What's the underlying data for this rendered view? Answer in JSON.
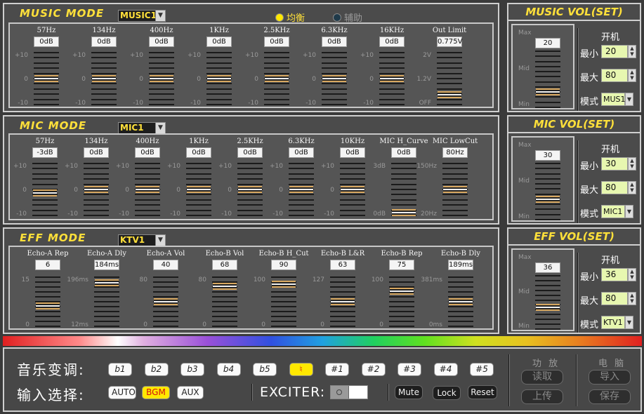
{
  "music": {
    "title": "MUSIC MODE",
    "preset": "MUSIC1",
    "radio_eq": "均衡",
    "radio_aux": "辅助",
    "channels": [
      {
        "label": "57Hz",
        "value": "0dB",
        "level": 0.5
      },
      {
        "label": "134Hz",
        "value": "0dB",
        "level": 0.5
      },
      {
        "label": "400Hz",
        "value": "0dB",
        "level": 0.5
      },
      {
        "label": "1KHz",
        "value": "0dB",
        "level": 0.5
      },
      {
        "label": "2.5KHz",
        "value": "0dB",
        "level": 0.5
      },
      {
        "label": "6.3KHz",
        "value": "0dB",
        "level": 0.5
      },
      {
        "label": "16KHz",
        "value": "0dB",
        "level": 0.5
      },
      {
        "label": "Out Limit",
        "value": "0.775V",
        "level": 0.15
      }
    ],
    "axis_top": "+10",
    "axis_mid": "0",
    "axis_bot": "-10",
    "limit_top": "2V",
    "limit_mid": "1.2V",
    "limit_bot": "OFF"
  },
  "mic": {
    "title": "MIC MODE",
    "preset": "MIC1",
    "channels": [
      {
        "label": "57Hz",
        "value": "-3dB",
        "level": 0.43
      },
      {
        "label": "134Hz",
        "value": "0dB",
        "level": 0.5
      },
      {
        "label": "400Hz",
        "value": "0dB",
        "level": 0.5
      },
      {
        "label": "1KHz",
        "value": "0dB",
        "level": 0.5
      },
      {
        "label": "2.5KHz",
        "value": "0dB",
        "level": 0.5
      },
      {
        "label": "6.3KHz",
        "value": "0dB",
        "level": 0.5
      },
      {
        "label": "10KHz",
        "value": "0dB",
        "level": 0.5
      },
      {
        "label": "MIC H_Curve",
        "value": "0dB",
        "level": 0.0
      },
      {
        "label": "MIC LowCut",
        "value": "80Hz",
        "level": 0.5
      }
    ],
    "hcurve_top": "3dB",
    "hcurve_bot": "0dB",
    "lowcut_top": "150Hz",
    "lowcut_bot": "20Hz"
  },
  "eff": {
    "title": "EFF MODE",
    "preset": "KTV1",
    "channels": [
      {
        "label": "Echo-A Rep",
        "value": "6",
        "level": 0.4,
        "top": "15",
        "bot": "0"
      },
      {
        "label": "Echo-A Dly",
        "value": "184ms",
        "level": 0.94,
        "top": "196ms",
        "bot": "12ms"
      },
      {
        "label": "Echo-A Vol",
        "value": "40",
        "level": 0.5,
        "top": "80",
        "bot": "0"
      },
      {
        "label": "Echo-B Vol",
        "value": "68",
        "level": 0.85,
        "top": "80",
        "bot": "0"
      },
      {
        "label": "Echo-B H_Cut",
        "value": "90",
        "level": 0.9,
        "top": "100",
        "bot": "0"
      },
      {
        "label": "Echo-B L&R",
        "value": "63",
        "level": 0.5,
        "top": "127",
        "bot": "0"
      },
      {
        "label": "Echo-B Rep",
        "value": "75",
        "level": 0.75,
        "top": "100",
        "bot": "0"
      },
      {
        "label": "Echo-B Dly",
        "value": "189ms",
        "level": 0.5,
        "top": "381ms",
        "bot": "0ms"
      }
    ]
  },
  "vol_panels": [
    {
      "title": "MUSIC VOL(SET)",
      "value": "20",
      "level": 0.25,
      "on_label": "开机",
      "min_label": "最小",
      "min": "20",
      "max_label": "最大",
      "max": "80",
      "mode_label": "模式",
      "mode": "MUS1"
    },
    {
      "title": "MIC VOL(SET)",
      "value": "30",
      "level": 0.35,
      "on_label": "开机",
      "min_label": "最小",
      "min": "30",
      "max_label": "最大",
      "max": "80",
      "mode_label": "模式",
      "mode": "MIC1"
    },
    {
      "title": "EFF VOL(SET)",
      "value": "36",
      "level": 0.4,
      "on_label": "开机",
      "min_label": "最小",
      "min": "36",
      "max_label": "最大",
      "max": "80",
      "mode_label": "模式",
      "mode": "KTV1"
    }
  ],
  "vol_axis": {
    "max": "Max",
    "mid": "Mid",
    "min": "Min"
  },
  "bottom": {
    "key_label": "音乐变调:",
    "keys": [
      "b1",
      "b2",
      "b3",
      "b4",
      "b5",
      "♮",
      "#1",
      "#2",
      "#3",
      "#4",
      "#5"
    ],
    "active_key": 5,
    "input_label": "输入选择:",
    "inputs": [
      "AUTO",
      "BGM",
      "AUX"
    ],
    "active_input": 1,
    "exciter_label": "EXCITER:",
    "mute": "Mute",
    "lock": "Lock",
    "reset": "Reset",
    "amp_head": "功 放",
    "amp_read": "读取",
    "amp_upload": "上传",
    "pc_head": "电 脑",
    "pc_import": "导入",
    "pc_save": "保存"
  }
}
